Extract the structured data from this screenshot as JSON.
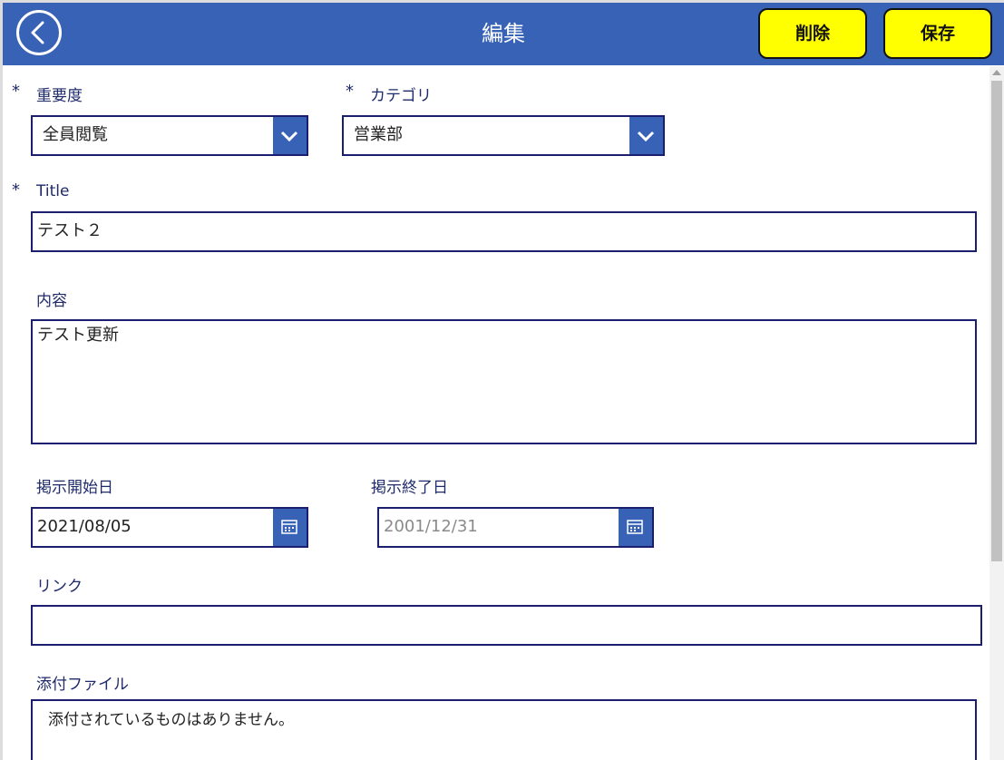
{
  "header": {
    "title": "編集",
    "delete_label": "削除",
    "save_label": "保存"
  },
  "form": {
    "importance": {
      "required_mark": "*",
      "label": "重要度",
      "value": "全員閲覧"
    },
    "category": {
      "required_mark": "*",
      "label": "カテゴリ",
      "value": "営業部"
    },
    "title_field": {
      "required_mark": "*",
      "label": "Title",
      "value": "テスト２"
    },
    "content": {
      "label": "内容",
      "value": "テスト更新"
    },
    "start_date": {
      "label": "掲示開始日",
      "value": "2021/08/05"
    },
    "end_date": {
      "label": "掲示終了日",
      "value": "2001/12/31"
    },
    "link": {
      "label": "リンク",
      "value": ""
    },
    "attachments": {
      "label": "添付ファイル",
      "empty_text": "添付されているものはありません。"
    }
  },
  "colors": {
    "header_bg": "#3862b5",
    "button_bg": "#ffff00",
    "label_text": "#1f2a6b",
    "field_border": "#1b1e6e"
  },
  "icons": [
    "back-arrow-icon",
    "chevron-down-icon",
    "calendar-icon"
  ]
}
